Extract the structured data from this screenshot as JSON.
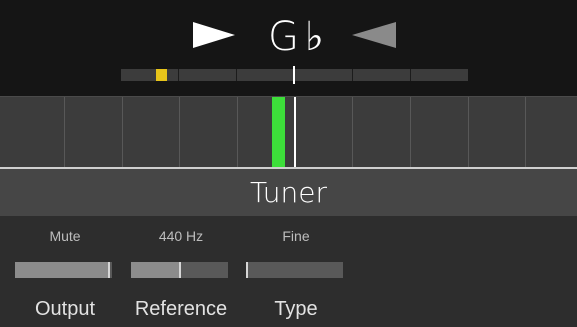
{
  "tuner": {
    "note": "G♭",
    "flat_arrow_icon": "play-right-icon",
    "sharp_arrow_icon": "play-left-icon",
    "coarse_marker_color": "#e8c51a",
    "strobe_bar_color": "#3dde3a"
  },
  "title": "Tuner",
  "params": [
    {
      "value": "Mute",
      "label": "Output",
      "level": 0.98
    },
    {
      "value": "440 Hz",
      "label": "Reference",
      "level": 0.5
    },
    {
      "value": "Fine",
      "label": "Type",
      "level": 0.0
    }
  ]
}
